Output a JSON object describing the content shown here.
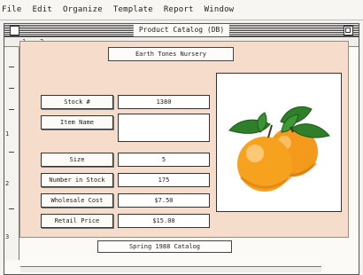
{
  "menubar": {
    "items": [
      "File",
      "Edit",
      "Organize",
      "Template",
      "Report",
      "Window"
    ]
  },
  "window": {
    "title": "Product Catalog (DB)",
    "ruler_marks": [
      "1",
      "2"
    ],
    "left_ruler_marks": [
      "1",
      "2",
      "3"
    ]
  },
  "form": {
    "banner": "Earth Tones Nursery",
    "fields": [
      {
        "label": "Stock #",
        "value": "1380"
      },
      {
        "label": "Item Name",
        "value": ""
      },
      {
        "label": "Size",
        "value": "5"
      },
      {
        "label": "Number in Stock",
        "value": "175"
      },
      {
        "label": "Wholesale Cost",
        "value": "$7.50"
      },
      {
        "label": "Retail Price",
        "value": "$15.00"
      }
    ],
    "footer": "Spring 1988 Catalog"
  },
  "colors": {
    "panel_bg": "#f6dccb",
    "orange": "#f39a1c",
    "leaf": "#2f7f2a"
  },
  "image": {
    "subject": "oranges-with-leaves"
  }
}
